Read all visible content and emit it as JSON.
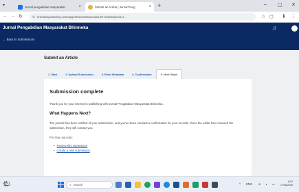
{
  "browser": {
    "tabs": [
      {
        "title": "Jurnal pengabdian masyarakat",
        "active": false
      },
      {
        "title": "Submit an Article | Jurnal Peng",
        "active": true
      }
    ],
    "new_tab_symbol": "+",
    "url": "bhinnekapublishing.com/ojs/jpmb/submission/wizard/3?submissionId=1..."
  },
  "site": {
    "title": "Jurnal Pengabdian Masyarakat Bhinneka",
    "back_link": "← Back to Submissions"
  },
  "page": {
    "heading": "Submit an Article",
    "steps": [
      {
        "label": "1. Start",
        "active": false
      },
      {
        "label": "2. Upload Submission",
        "active": false
      },
      {
        "label": "3. Enter Metadata",
        "active": false
      },
      {
        "label": "4. Confirmation",
        "active": false
      },
      {
        "label": "5. Next Steps",
        "active": true
      }
    ],
    "panel": {
      "title": "Submission complete",
      "thanks": "Thank you for your interest in publishing with Jurnal Pengabdian Masyarakat Bhinneka.",
      "next_heading": "What Happens Next?",
      "next_body": "The journal has been notified of your submission, and you've been emailed a confirmation for your records. Once the editor has reviewed the submission, they will contact you.",
      "for_now": "For now, you can:",
      "links": [
        "Review this submission",
        "Create a new submission"
      ]
    }
  },
  "taskbar": {
    "search_placeholder": "Search",
    "lang": "ENG",
    "time": "8:57",
    "date": "17/06/2025"
  },
  "colors": {
    "header_bg": "#0b2a63",
    "link": "#1e5aa8",
    "page_bg": "#eef0f3"
  }
}
